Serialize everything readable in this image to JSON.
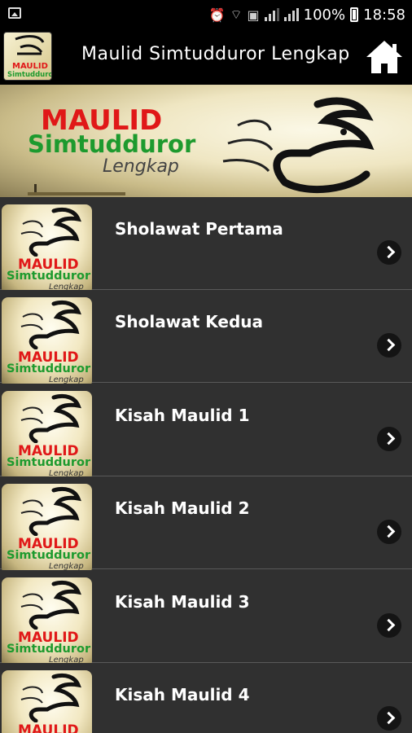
{
  "status_bar": {
    "battery": "100%",
    "time": "18:58",
    "icons": [
      "gallery-icon",
      "alarm-icon",
      "wifi-icon",
      "data-icon",
      "signal-icon",
      "signal-icon",
      "battery-icon"
    ]
  },
  "app_bar": {
    "title": "Maulid Simtudduror Lengkap",
    "logo_lines": [
      "MAULID",
      "Simtudduror"
    ],
    "home_icon": "home-icon"
  },
  "banner": {
    "line1": "MAULID",
    "line2": "Simtudduror",
    "line3": "Lengkap"
  },
  "thumb_text": {
    "line1": "MAULID",
    "line2": "Simtudduror",
    "line3": "Lengkap"
  },
  "items": [
    {
      "label": "Sholawat Pertama"
    },
    {
      "label": "Sholawat Kedua"
    },
    {
      "label": "Kisah Maulid 1"
    },
    {
      "label": "Kisah Maulid 2"
    },
    {
      "label": "Kisah Maulid 3"
    },
    {
      "label": "Kisah Maulid 4"
    }
  ],
  "colors": {
    "red": "#e01818",
    "green": "#1d9a2e",
    "list_bg": "#303030"
  }
}
